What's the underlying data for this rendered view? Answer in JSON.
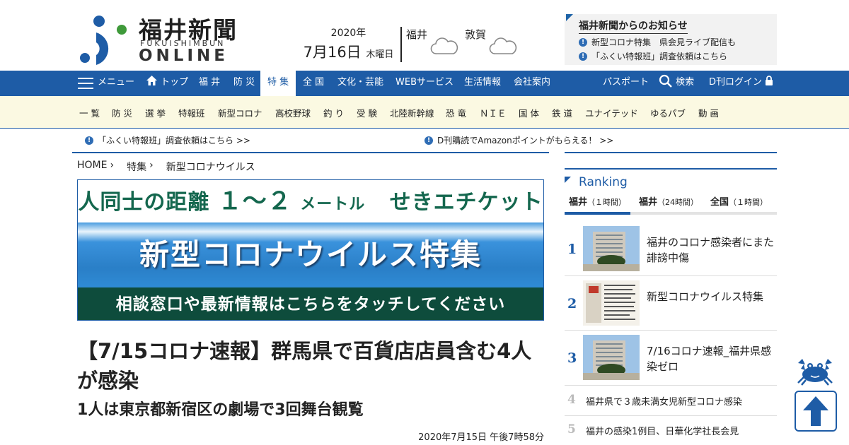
{
  "header": {
    "logo_title": "福井新聞",
    "logo_sub": "FUKUISHIMBUN",
    "logo_online": "ONLINE",
    "date_year": "2020年",
    "date_main": "7月16日",
    "date_weekday": "木曜日",
    "weather": [
      {
        "city": "福井",
        "icon": "cloud-icon"
      },
      {
        "city": "敦賀",
        "icon": "cloud-icon"
      }
    ],
    "notice": {
      "title": "福井新聞からのお知らせ",
      "items": [
        "新型コロナ特集　県会見ライブ配信も",
        "「ふくい特報班」調査依頼はこちら"
      ]
    }
  },
  "nav": {
    "menu": "メニュー",
    "top": "トップ",
    "items": [
      "福 井",
      "防 災",
      "特 集",
      "全 国",
      "文化・芸能",
      "WEBサービス",
      "生活情報",
      "会社案内"
    ],
    "active_index": 2,
    "passport": "パスポート",
    "search": "検索",
    "login": "D刊ログイン"
  },
  "subnav": {
    "items": [
      "一 覧",
      "防 災",
      "選 挙",
      "特報班",
      "新型コロナ",
      "高校野球",
      "釣 り",
      "受 験",
      "北陸新幹線",
      "恐 竜",
      "ＮＩＥ",
      "国 体",
      "鉄 道",
      "ユナイテッド",
      "ゆるパブ",
      "動 画"
    ]
  },
  "info_row": [
    "「ふくい特報班」調査依頼はこちら >>",
    "D刊購読でAmazonポイントがもらえる！ >>"
  ],
  "breadcrumb": [
    "HOME",
    "特集",
    "新型コロナウイルス"
  ],
  "banner": {
    "top_a": "人同士の距離",
    "top_b": "１〜２",
    "top_c": "メートル",
    "top_d": "せきエチケット",
    "mid": "新型コロナウイルス特集",
    "bottom": "相談窓口や最新情報はこちらをタッチしてください"
  },
  "article": {
    "headline": "【7/15コロナ速報】群馬県で百貨店店員含む4人が感染",
    "subhead": "1人は東京都新宿区の劇場で3回舞台観覧",
    "published": "2020年7月15日 午後7時58分"
  },
  "ranking": {
    "title": "Ranking",
    "tabs": [
      {
        "name": "福井",
        "period": "（１時間）"
      },
      {
        "name": "福井",
        "period": "（24時間）"
      },
      {
        "name": "全国",
        "period": "（１時間）"
      }
    ],
    "active_tab": 0,
    "items": [
      {
        "rank": "1",
        "text": "福井のコロナ感染者にまた誹謗中傷"
      },
      {
        "rank": "2",
        "text": "新型コロナウイルス特集"
      },
      {
        "rank": "3",
        "text": "7/16コロナ速報_福井県感染ゼロ"
      },
      {
        "rank": "4",
        "text": "福井県で３歳未満女児新型コロナ感染"
      },
      {
        "rank": "5",
        "text": "福井の感染1例目、日華化学社長会見"
      }
    ]
  },
  "colors": {
    "brand_blue": "#1e5ca6",
    "subnav_bg": "#fbf9e2",
    "banner_green": "#0e4c3c"
  }
}
